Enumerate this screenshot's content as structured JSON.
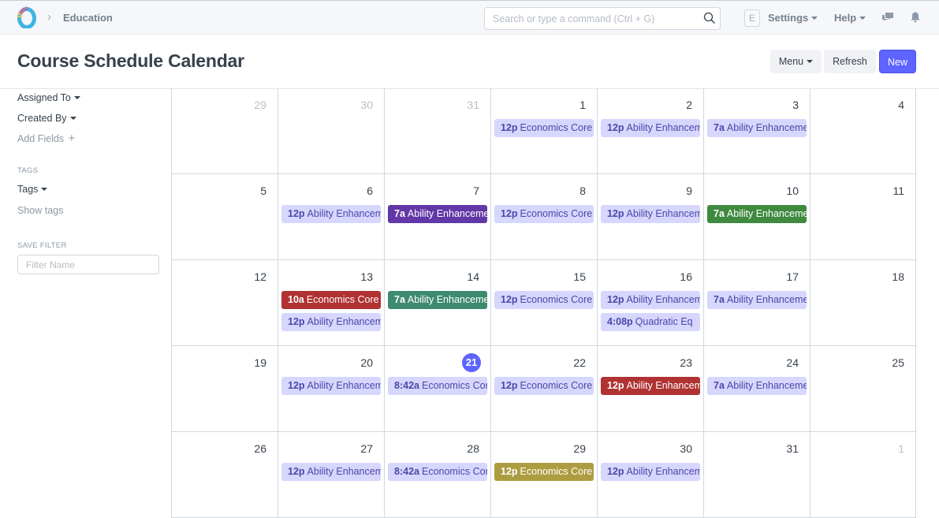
{
  "navbar": {
    "breadcrumb": "Education",
    "search_placeholder": "Search or type a command (Ctrl + G)",
    "avatar_initial": "E",
    "settings_label": "Settings",
    "help_label": "Help"
  },
  "page": {
    "title": "Course Schedule Calendar",
    "menu_label": "Menu",
    "refresh_label": "Refresh",
    "new_label": "New"
  },
  "sidebar": {
    "assigned_to": "Assigned To",
    "created_by": "Created By",
    "add_fields": "Add Fields",
    "tags_heading": "TAGS",
    "tags_label": "Tags",
    "show_tags": "Show tags",
    "save_filter_heading": "SAVE FILTER",
    "filter_placeholder": "Filter Name"
  },
  "colors": {
    "primary": "#5e64ff",
    "event_default_bg": "#d7d6fd",
    "event_default_fg": "#4a48a8",
    "purple": "#6237a7",
    "green": "#3f8a3f",
    "teal": "#3e8a6e",
    "red": "#b03232",
    "olive": "#ad9d40"
  },
  "calendar": {
    "weeks": [
      [
        {
          "day": "29",
          "other": true,
          "events": []
        },
        {
          "day": "30",
          "other": true,
          "events": []
        },
        {
          "day": "31",
          "other": true,
          "events": []
        },
        {
          "day": "1",
          "events": [
            {
              "time": "12p",
              "title": "Economics Core",
              "color": "default"
            }
          ]
        },
        {
          "day": "2",
          "events": [
            {
              "time": "12p",
              "title": "Ability Enhancement",
              "color": "default"
            }
          ]
        },
        {
          "day": "3",
          "events": [
            {
              "time": "7a",
              "title": "Ability Enhancement",
              "color": "default"
            }
          ]
        },
        {
          "day": "4",
          "events": []
        }
      ],
      [
        {
          "day": "5",
          "events": []
        },
        {
          "day": "6",
          "events": [
            {
              "time": "12p",
              "title": "Ability Enhancement",
              "color": "default"
            }
          ]
        },
        {
          "day": "7",
          "events": [
            {
              "time": "7a",
              "title": "Ability Enhancement",
              "color": "purple"
            }
          ]
        },
        {
          "day": "8",
          "events": [
            {
              "time": "12p",
              "title": "Economics Core",
              "color": "default"
            }
          ]
        },
        {
          "day": "9",
          "events": [
            {
              "time": "12p",
              "title": "Ability Enhancement",
              "color": "default"
            }
          ]
        },
        {
          "day": "10",
          "events": [
            {
              "time": "7a",
              "title": "Ability Enhancement",
              "color": "green"
            }
          ]
        },
        {
          "day": "11",
          "events": []
        }
      ],
      [
        {
          "day": "12",
          "events": []
        },
        {
          "day": "13",
          "events": [
            {
              "time": "10a",
              "title": "Economics Core",
              "color": "red"
            },
            {
              "time": "12p",
              "title": "Ability Enhancement",
              "color": "default"
            }
          ]
        },
        {
          "day": "14",
          "events": [
            {
              "time": "7a",
              "title": "Ability Enhancement",
              "color": "teal"
            }
          ]
        },
        {
          "day": "15",
          "events": [
            {
              "time": "12p",
              "title": "Economics Core",
              "color": "default"
            }
          ]
        },
        {
          "day": "16",
          "events": [
            {
              "time": "12p",
              "title": "Ability Enhancement",
              "color": "default"
            },
            {
              "time": "4:08p",
              "title": "Quadratic Eq",
              "color": "default"
            }
          ]
        },
        {
          "day": "17",
          "events": [
            {
              "time": "7a",
              "title": "Ability Enhancement",
              "color": "default"
            }
          ]
        },
        {
          "day": "18",
          "events": []
        }
      ],
      [
        {
          "day": "19",
          "events": []
        },
        {
          "day": "20",
          "events": [
            {
              "time": "12p",
              "title": "Ability Enhancement",
              "color": "default"
            }
          ]
        },
        {
          "day": "21",
          "today": true,
          "events": [
            {
              "time": "8:42a",
              "title": "Economics Core",
              "color": "default"
            }
          ]
        },
        {
          "day": "22",
          "events": [
            {
              "time": "12p",
              "title": "Economics Core",
              "color": "default"
            }
          ]
        },
        {
          "day": "23",
          "events": [
            {
              "time": "12p",
              "title": "Ability Enhancement",
              "color": "red"
            }
          ]
        },
        {
          "day": "24",
          "events": [
            {
              "time": "7a",
              "title": "Ability Enhancement",
              "color": "default"
            }
          ]
        },
        {
          "day": "25",
          "events": []
        }
      ],
      [
        {
          "day": "26",
          "events": []
        },
        {
          "day": "27",
          "events": [
            {
              "time": "12p",
              "title": "Ability Enhancement",
              "color": "default"
            }
          ]
        },
        {
          "day": "28",
          "events": [
            {
              "time": "8:42a",
              "title": "Economics Core",
              "color": "default"
            }
          ]
        },
        {
          "day": "29",
          "events": [
            {
              "time": "12p",
              "title": "Economics Core",
              "color": "olive"
            }
          ]
        },
        {
          "day": "30",
          "events": [
            {
              "time": "12p",
              "title": "Ability Enhancement",
              "color": "default"
            }
          ]
        },
        {
          "day": "31",
          "events": []
        },
        {
          "day": "1",
          "other": true,
          "events": []
        }
      ]
    ]
  }
}
